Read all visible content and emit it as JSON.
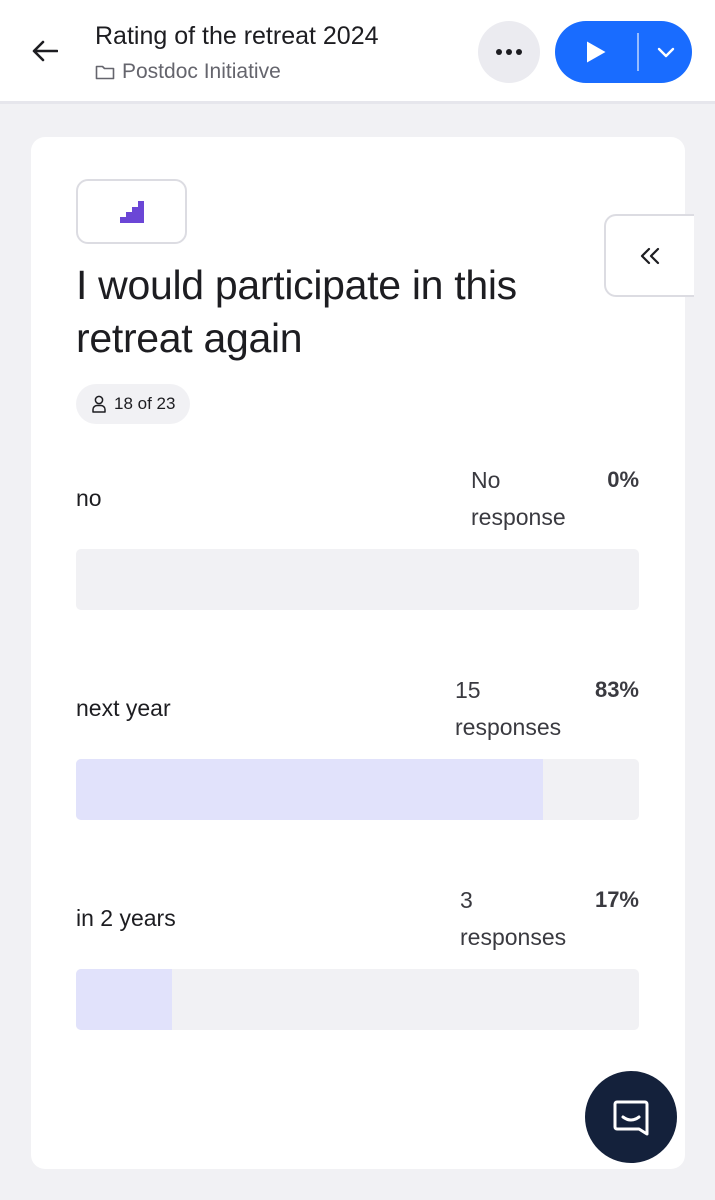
{
  "header": {
    "title": "Rating of the retreat 2024",
    "folder": "Postdoc Initiative",
    "accent_color": "#196cff"
  },
  "question": {
    "text": "I would participate in this retreat again",
    "type_icon": "scales-icon",
    "respondents": "18 of 23"
  },
  "options": [
    {
      "label": "no",
      "count_line1": "No",
      "count_line2": "response",
      "percent": "0%",
      "fraction": 0.0
    },
    {
      "label": "next year",
      "count_line1": "15",
      "count_line2": "responses",
      "percent": "83%",
      "fraction": 0.83
    },
    {
      "label": "in 2 years",
      "count_line1": "3",
      "count_line2": "responses",
      "percent": "17%",
      "fraction": 0.17
    }
  ]
}
